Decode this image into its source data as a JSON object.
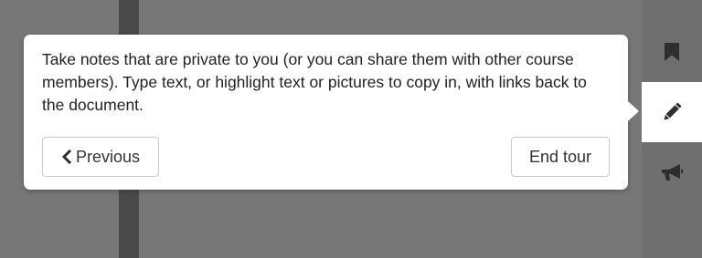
{
  "tour": {
    "message": "Take notes that are private to you (or you can share them with other course members). Type text, or highlight text or pictures to copy in, with links back to the document.",
    "previous_label": "Previous",
    "end_label": "End tour"
  },
  "toolbar": {
    "items": [
      {
        "icon": "bookmark-icon",
        "active": false
      },
      {
        "icon": "pencil-icon",
        "active": true
      },
      {
        "icon": "megaphone-icon",
        "active": false
      }
    ]
  },
  "colors": {
    "backdrop": "#777777",
    "stripe": "#4a4a4a",
    "icon": "#2e2e2e",
    "tooltip_bg": "#ffffff",
    "text": "#222222"
  }
}
